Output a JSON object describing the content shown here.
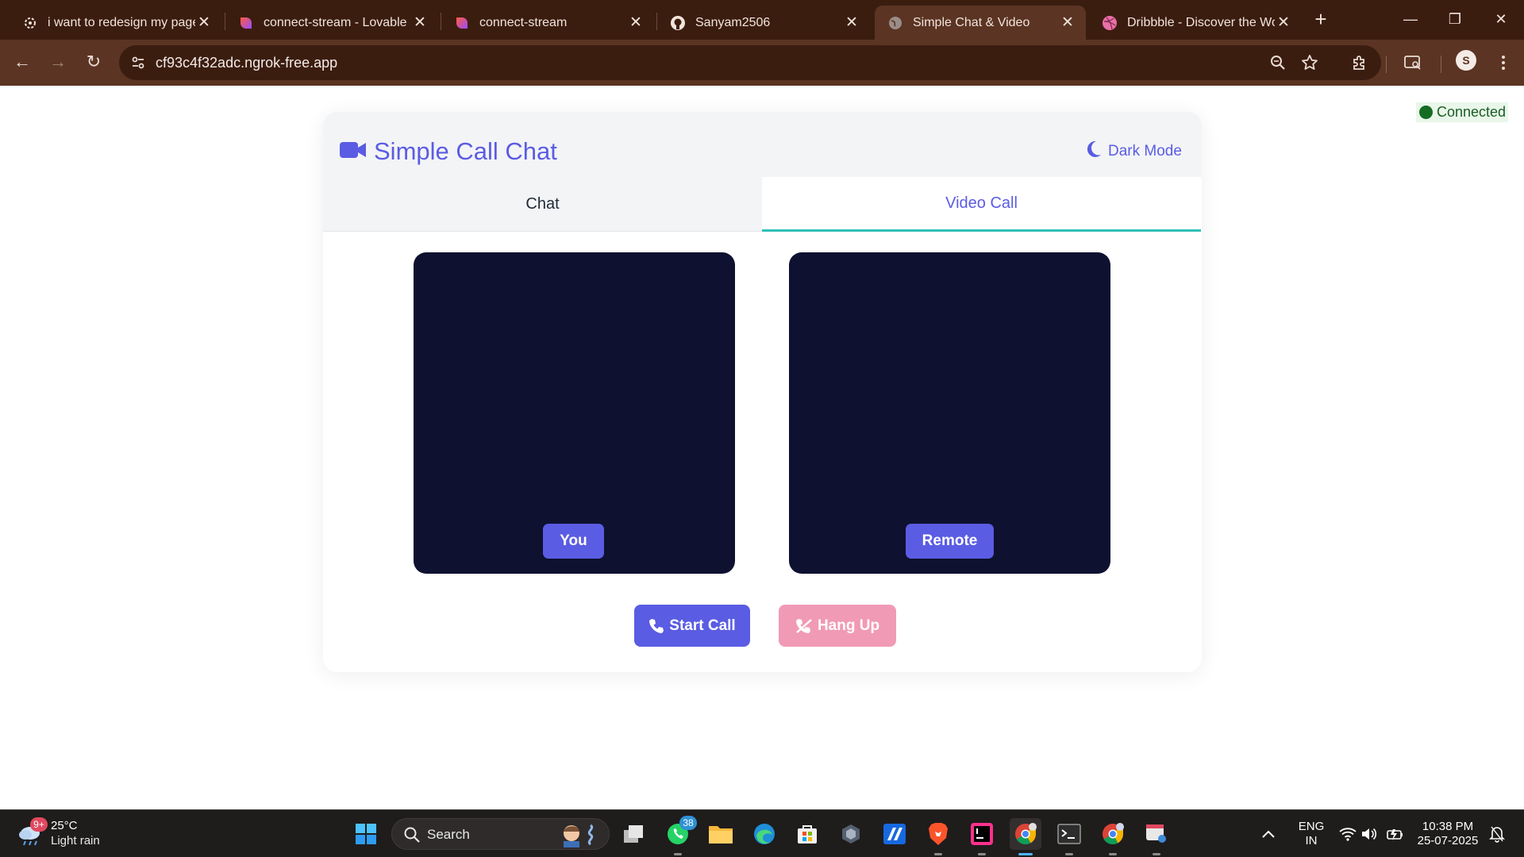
{
  "browser": {
    "tabs": [
      {
        "title": "i want to redesign my page",
        "icon": "gear-logo-icon"
      },
      {
        "title": "connect-stream - Lovable",
        "icon": "lovable-heart-icon"
      },
      {
        "title": "connect-stream",
        "icon": "lovable-heart-icon"
      },
      {
        "title": "Sanyam2506",
        "icon": "github-icon"
      },
      {
        "title": "Simple Chat & Video",
        "icon": "globe-icon",
        "active": true
      },
      {
        "title": "Dribbble - Discover the Wor",
        "icon": "dribbble-icon"
      }
    ],
    "url": "cf93c4f32adc.ngrok-free.app",
    "profile_initial": "S"
  },
  "status": {
    "label": "Connected",
    "color": "#166d21"
  },
  "app": {
    "title": "Simple Call Chat",
    "dark_mode_label": "Dark Mode",
    "accent": "#5a5ce3",
    "tabs": [
      {
        "label": "Chat",
        "active": false
      },
      {
        "label": "Video Call",
        "active": true
      }
    ],
    "video": {
      "local_label": "You",
      "remote_label": "Remote"
    },
    "buttons": {
      "start_call": "Start Call",
      "hang_up": "Hang Up"
    }
  },
  "taskbar": {
    "weather": {
      "temp": "25°C",
      "condition": "Light rain",
      "badge": "9+"
    },
    "search_label": "Search",
    "whatsapp_badge": "38",
    "language": {
      "line1": "ENG",
      "line2": "IN"
    },
    "clock": {
      "time": "10:38 PM",
      "date": "25-07-2025"
    }
  }
}
